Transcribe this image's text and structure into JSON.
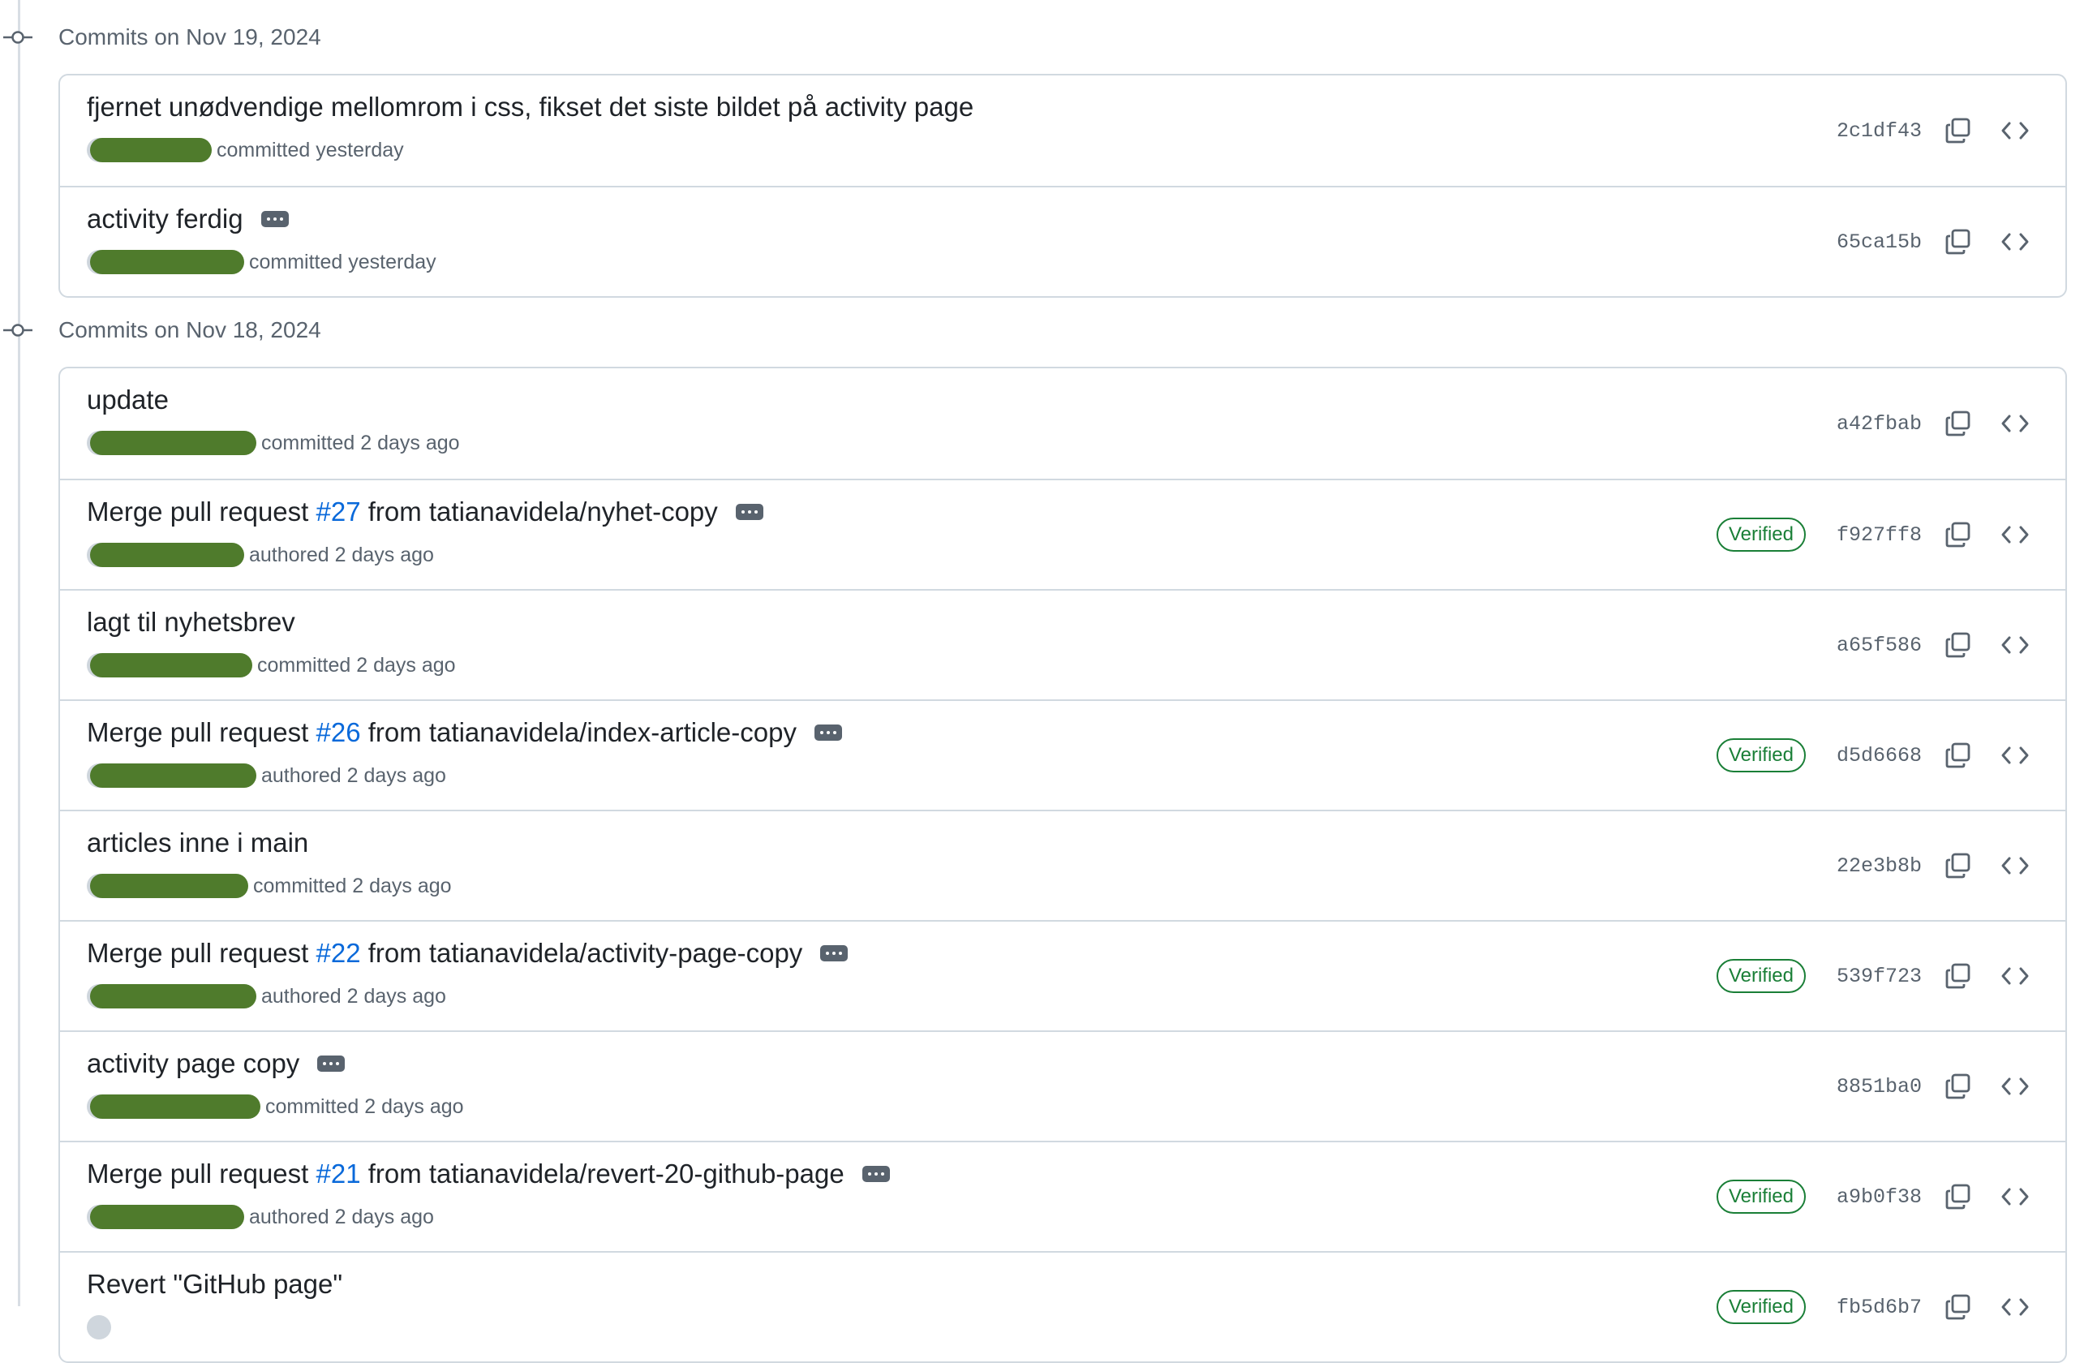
{
  "groups": [
    {
      "title": "Commits on Nov 19, 2024",
      "commits": [
        {
          "message": "fjernet unødvendige mellomrom i css, fikset det siste bildet på activity page",
          "pr_number": "",
          "message_suffix": "",
          "has_ellipsis": false,
          "action_text": "committed yesterday",
          "verified": "",
          "sha": "2c1df43"
        },
        {
          "message": "activity ferdig",
          "pr_number": "",
          "message_suffix": "",
          "has_ellipsis": true,
          "action_text": "committed yesterday",
          "verified": "",
          "sha": "65ca15b"
        }
      ]
    },
    {
      "title": "Commits on Nov 18, 2024",
      "commits": [
        {
          "message": "update",
          "pr_number": "",
          "message_suffix": "",
          "has_ellipsis": false,
          "action_text": "committed 2 days ago",
          "verified": "",
          "sha": "a42fbab"
        },
        {
          "message": "Merge pull request ",
          "pr_number": "#27",
          "message_suffix": " from tatianavidela/nyhet-copy",
          "has_ellipsis": true,
          "action_text": "authored 2 days ago",
          "verified": "Verified",
          "sha": "f927ff8"
        },
        {
          "message": "lagt til nyhetsbrev",
          "pr_number": "",
          "message_suffix": "",
          "has_ellipsis": false,
          "action_text": "committed 2 days ago",
          "verified": "",
          "sha": "a65f586"
        },
        {
          "message": "Merge pull request ",
          "pr_number": "#26",
          "message_suffix": " from tatianavidela/index-article-copy",
          "has_ellipsis": true,
          "action_text": "authored 2 days ago",
          "verified": "Verified",
          "sha": "d5d6668"
        },
        {
          "message": "articles inne i main",
          "pr_number": "",
          "message_suffix": "",
          "has_ellipsis": false,
          "action_text": "committed 2 days ago",
          "verified": "",
          "sha": "22e3b8b"
        },
        {
          "message": "Merge pull request ",
          "pr_number": "#22",
          "message_suffix": " from tatianavidela/activity-page-copy",
          "has_ellipsis": true,
          "action_text": "authored 2 days ago",
          "verified": "Verified",
          "sha": "539f723"
        },
        {
          "message": "activity page copy",
          "pr_number": "",
          "message_suffix": "",
          "has_ellipsis": true,
          "action_text": "committed 2 days ago",
          "verified": "",
          "sha": "8851ba0"
        },
        {
          "message": "Merge pull request ",
          "pr_number": "#21",
          "message_suffix": " from tatianavidela/revert-20-github-page",
          "has_ellipsis": true,
          "action_text": "authored 2 days ago",
          "verified": "Verified",
          "sha": "a9b0f38"
        },
        {
          "message": "Revert \"GitHub page\"",
          "pr_number": "",
          "message_suffix": "",
          "has_ellipsis": false,
          "action_text": "",
          "verified": "Verified",
          "sha": "fb5d6b7"
        }
      ]
    }
  ],
  "icons": {
    "group_marker": "git-commit-icon",
    "copy": "copy-icon",
    "browse": "code-icon"
  },
  "colors": {
    "link": "#0969da",
    "verified": "#1a7f37",
    "redaction": "#4f7b2c",
    "muted": "#59636e",
    "border": "#d1d9e0"
  }
}
